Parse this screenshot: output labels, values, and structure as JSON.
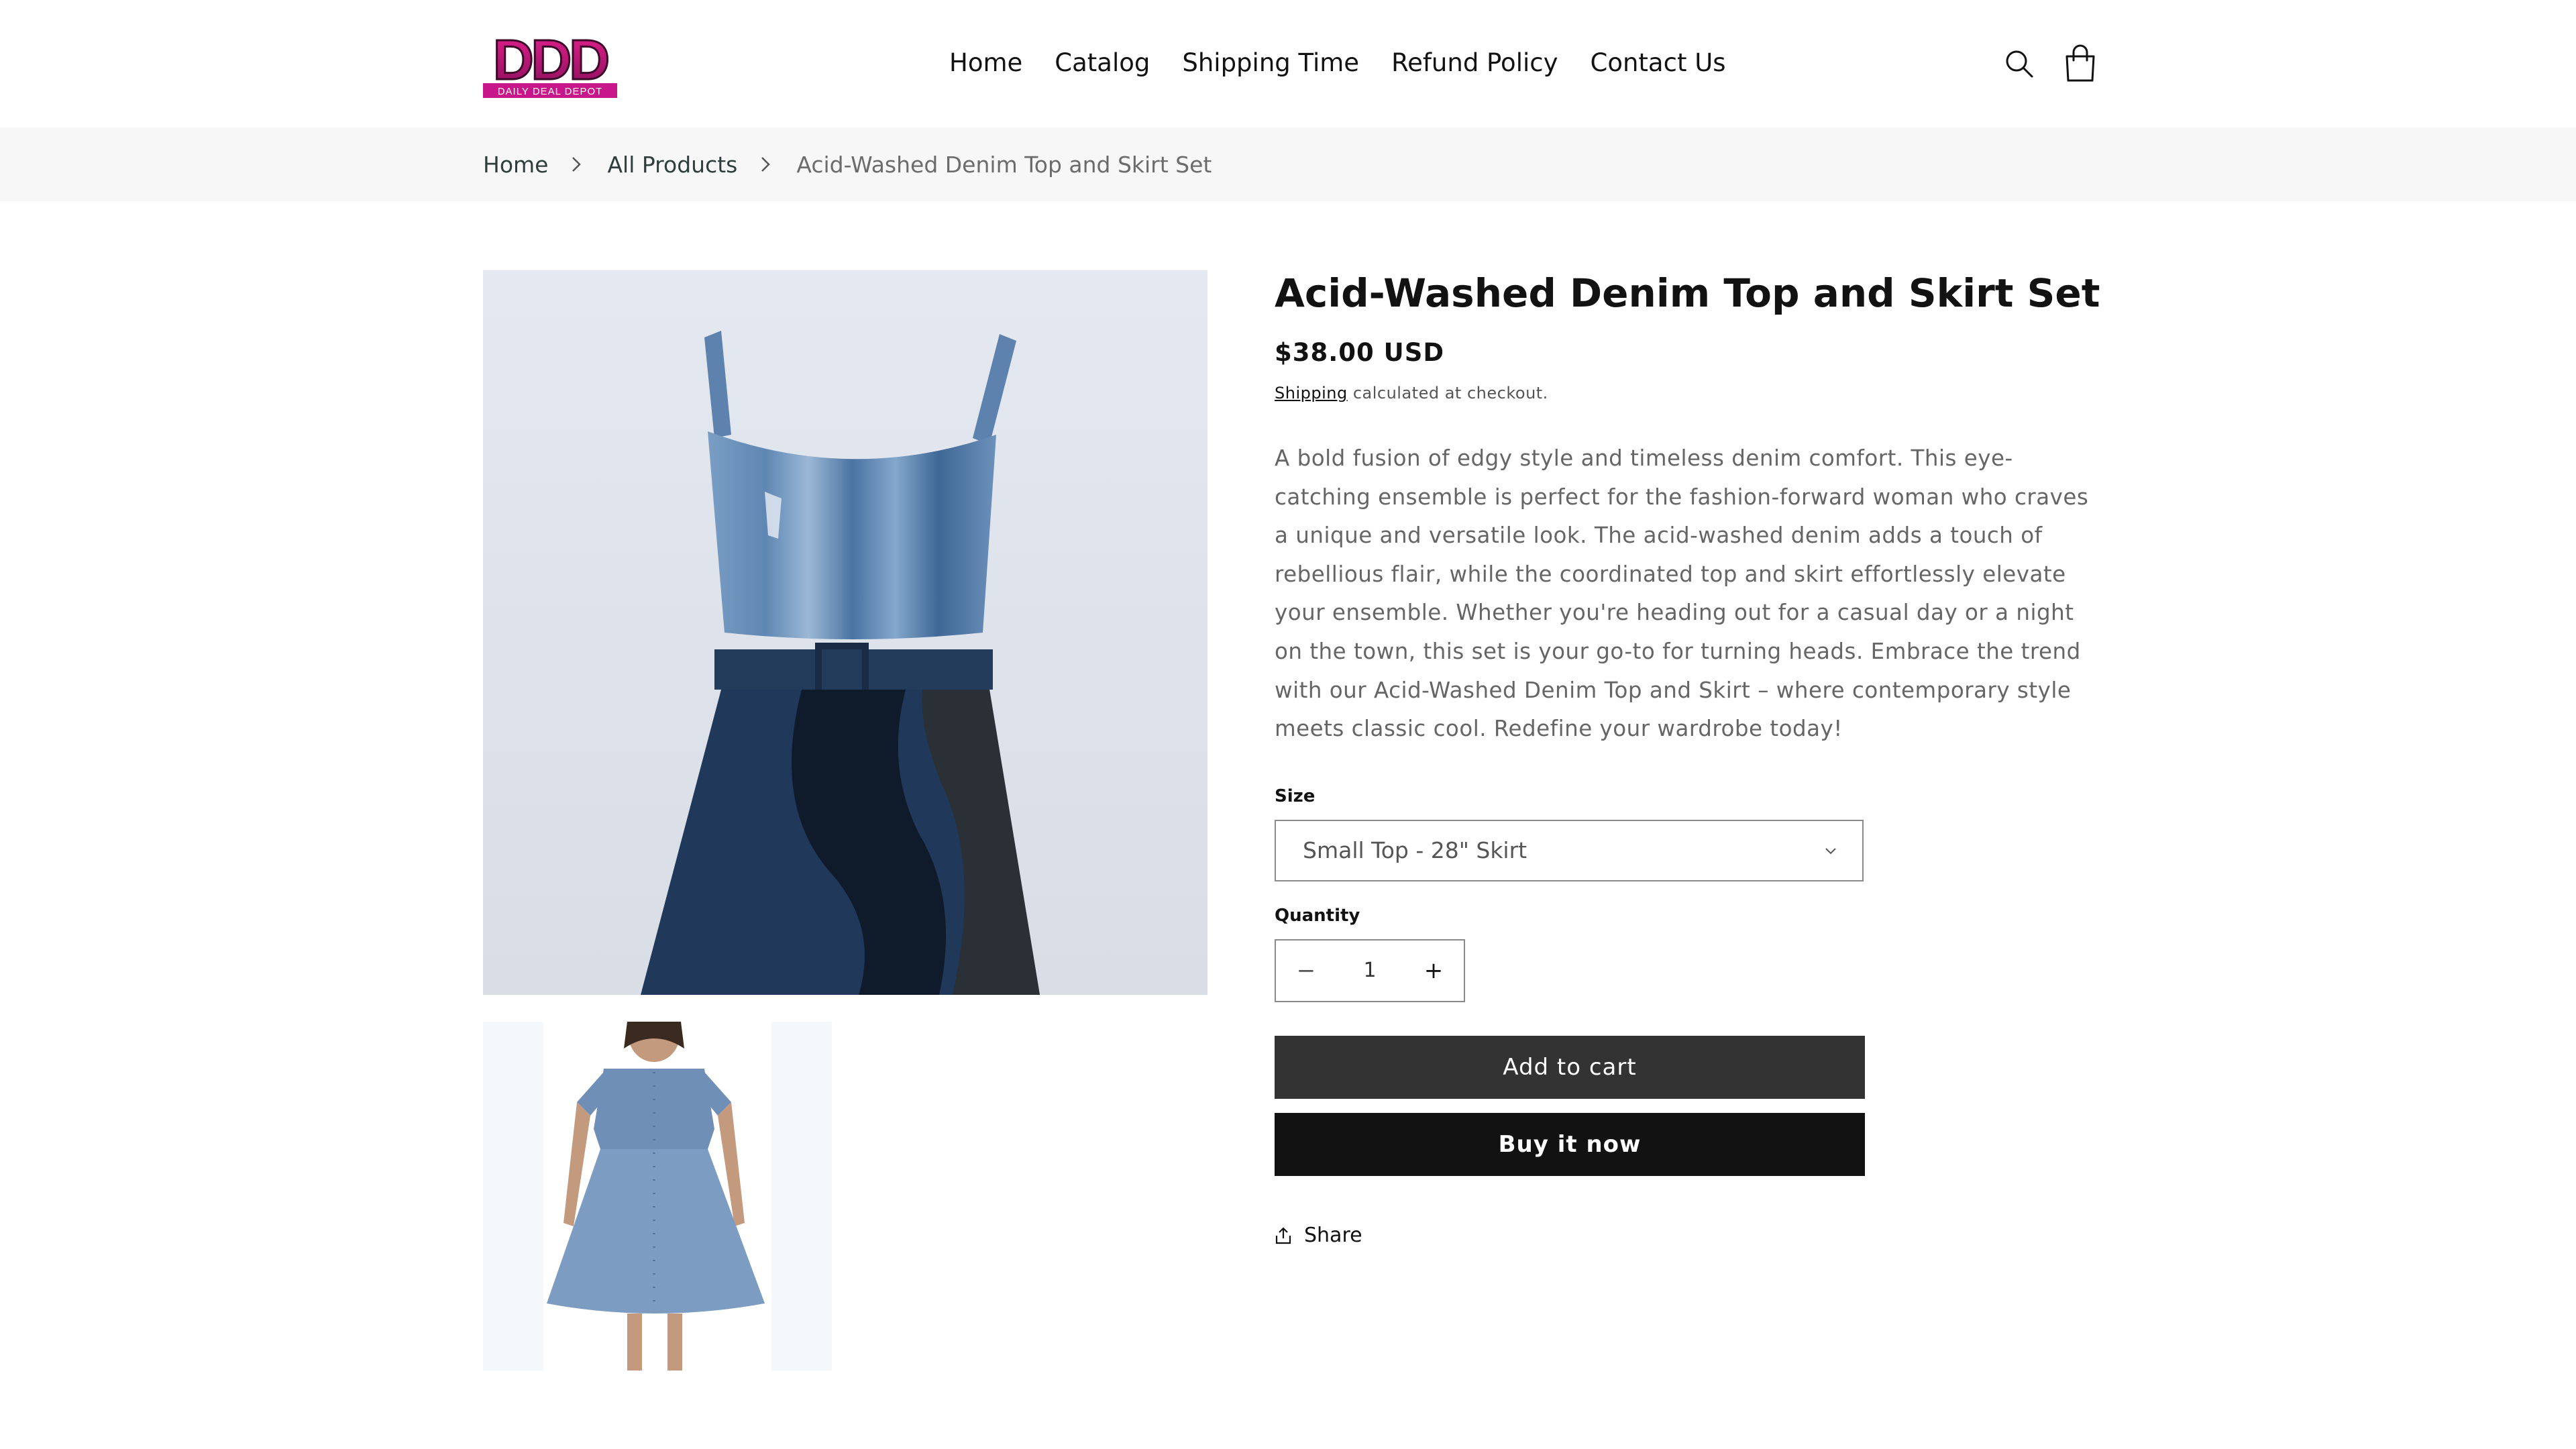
{
  "brand": {
    "logo_text": "DDD",
    "logo_tagline": "DAILY DEAL DEPOT",
    "accent": "#c8178a"
  },
  "nav": {
    "items": [
      "Home",
      "Catalog",
      "Shipping Time",
      "Refund Policy",
      "Contact Us"
    ]
  },
  "header_icons": {
    "search": "search-icon",
    "cart": "bag-icon"
  },
  "breadcrumb": {
    "home": "Home",
    "collection": "All Products",
    "current": "Acid-Washed Denim Top and Skirt Set"
  },
  "product": {
    "title": "Acid-Washed Denim Top and Skirt Set",
    "price": "$38.00 USD",
    "shipping_link": "Shipping",
    "shipping_note": " calculated at checkout.",
    "description": "A bold fusion of edgy style and timeless denim comfort. This eye-catching ensemble is perfect for the fashion-forward woman who craves a unique and versatile look. The acid-washed denim adds a touch of rebellious flair, while the coordinated top and skirt effortlessly elevate your ensemble. Whether you're heading out for a casual day or a night on the town, this set is your go-to for turning heads. Embrace the trend with our Acid-Washed Denim Top and Skirt – where contemporary style meets classic cool. Redefine your wardrobe today!",
    "size_label": "Size",
    "size_value": "Small Top - 28\" Skirt",
    "quantity_label": "Quantity",
    "quantity_value": "1",
    "quantity_minus": "−",
    "quantity_plus": "+",
    "add_to_cart": "Add to cart",
    "buy_now": "Buy it now",
    "share": "Share"
  },
  "colors": {
    "buy_now_bg": "#121212",
    "add_cart_bg": "#333333",
    "breadcrumb_bg": "#f7f7f7"
  }
}
